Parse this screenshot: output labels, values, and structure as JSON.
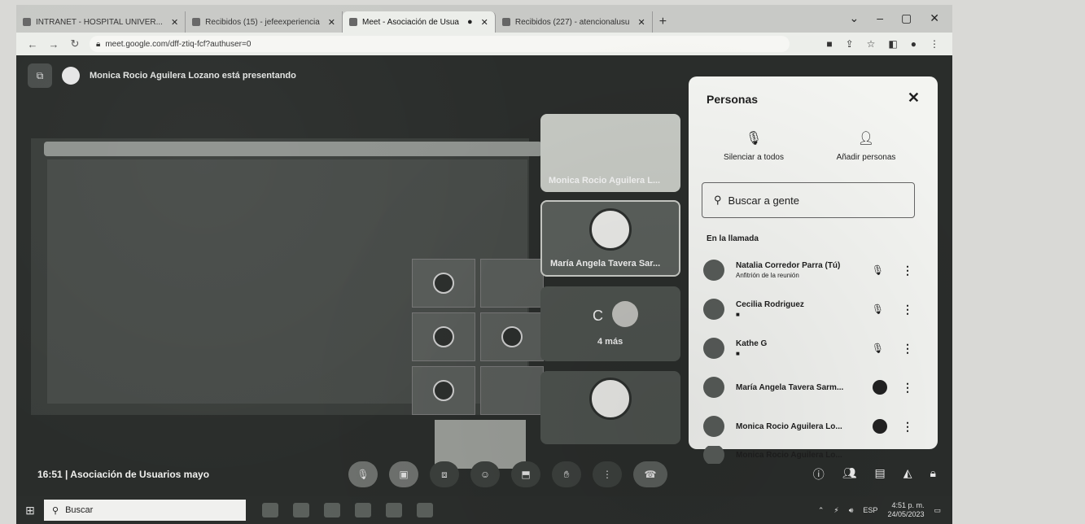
{
  "browser": {
    "tabs": [
      {
        "label": "INTRANET - HOSPITAL UNIVER..."
      },
      {
        "label": "Recibidos (15) - jefeexperiencia"
      },
      {
        "label": "Meet - Asociación de Usua"
      },
      {
        "label": "Recibidos (227) - atencionalusu"
      }
    ],
    "new_tab": "+",
    "url": "meet.google.com/dff-ztiq-fcf?authuser=0"
  },
  "meet": {
    "presenting_text": "Monica Rocio Aguilera Lozano está presentando",
    "tiles": [
      {
        "name": "Monica Rocio Aguilera L..."
      },
      {
        "name": "María Angela Tavera Sar..."
      },
      {
        "initial": "C",
        "more": "4 más"
      }
    ],
    "clock": "16:51",
    "separator": "|",
    "meeting_name": "Asociación de Usuarios mayo"
  },
  "people_panel": {
    "title": "Personas",
    "close": "✕",
    "mute_all": "Silenciar a todos",
    "add_people": "Añadir personas",
    "search_placeholder": "Buscar a gente",
    "section_label": "En la llamada",
    "participants": [
      {
        "name": "Natalia Corredor Parra (Tú)",
        "sub": "Anfitrión de la reunión"
      },
      {
        "name": "Cecilia Rodriguez",
        "sub": ""
      },
      {
        "name": "Kathe G",
        "sub": ""
      },
      {
        "name": "María Angela Tavera Sarm...",
        "sub": ""
      },
      {
        "name": "Monica Rocio Aguilera Lo...",
        "sub": ""
      },
      {
        "name": "Monica Rocio Aguilera Lo...",
        "sub": ""
      }
    ]
  },
  "taskbar": {
    "search_label": "Buscar",
    "time": "4:51 p. m.",
    "date": "24/05/2023",
    "lang": "ESP"
  }
}
